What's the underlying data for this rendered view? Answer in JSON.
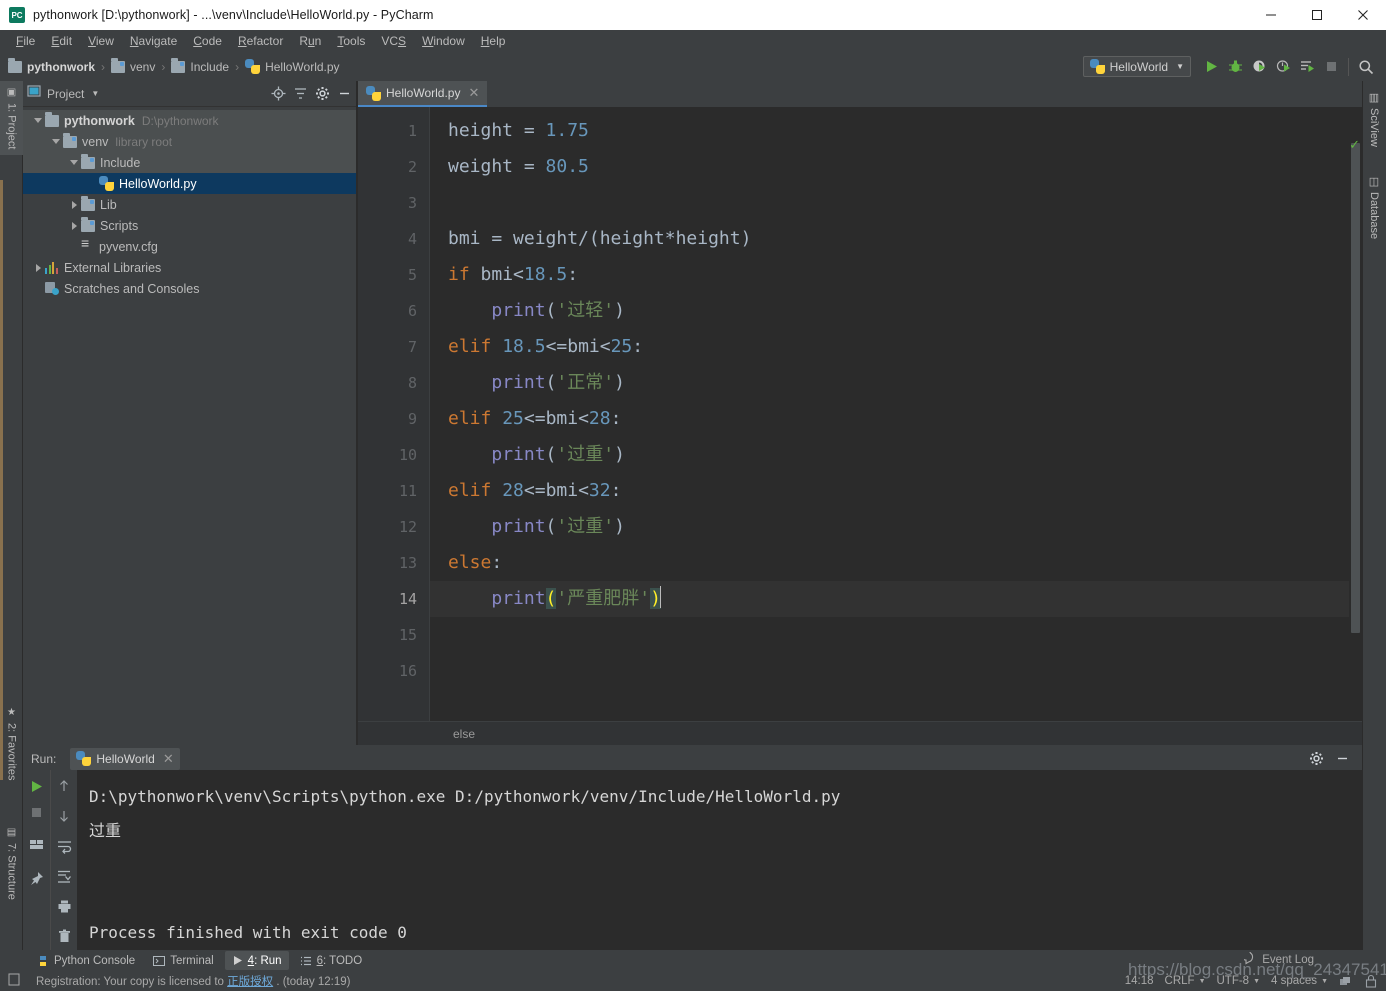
{
  "window": {
    "title": "pythonwork [D:\\pythonwork] - ...\\venv\\Include\\HelloWorld.py - PyCharm",
    "app_icon": "pycharm-icon",
    "minimize": "—",
    "maximize": "□",
    "close": "✕"
  },
  "menu": {
    "items": [
      {
        "label": "File",
        "accel": "F"
      },
      {
        "label": "Edit",
        "accel": "E"
      },
      {
        "label": "View",
        "accel": "V"
      },
      {
        "label": "Navigate",
        "accel": "N"
      },
      {
        "label": "Code",
        "accel": "C"
      },
      {
        "label": "Refactor",
        "accel": "R"
      },
      {
        "label": "Run",
        "accel": "u"
      },
      {
        "label": "Tools",
        "accel": "T"
      },
      {
        "label": "VCS",
        "accel": "S"
      },
      {
        "label": "Window",
        "accel": "W"
      },
      {
        "label": "Help",
        "accel": "H"
      }
    ]
  },
  "navbar": {
    "crumbs": [
      "pythonwork",
      "venv",
      "Include",
      "HelloWorld.py"
    ],
    "separator": "›",
    "run_config": "HelloWorld",
    "toolbar_icons": [
      "run-icon",
      "debug-icon",
      "run-coverage-icon",
      "profile-icon",
      "run-with-console-icon",
      "stop-icon",
      "search-everywhere-icon"
    ]
  },
  "left_strip": {
    "top_tab": {
      "label": "1: Project",
      "accel": "1"
    },
    "bottom_tabs": [
      {
        "label": "2: Favorites",
        "accel": "2",
        "icon": "star-icon"
      },
      {
        "label": "7: Structure",
        "accel": "7",
        "icon": "structure-icon"
      }
    ]
  },
  "right_strip": {
    "tabs": [
      {
        "label": "SciView",
        "icon": "sciview-icon"
      },
      {
        "label": "Database",
        "icon": "database-icon"
      }
    ]
  },
  "project_panel": {
    "title": "Project",
    "caret": "▾",
    "header_icons": [
      "locate-icon",
      "collapse-all-icon",
      "settings-icon",
      "hide-icon"
    ],
    "tree": [
      {
        "label": "pythonwork",
        "sub": "D:\\pythonwork",
        "icon": "folder-icon",
        "depth": 0,
        "expanded": true,
        "bold": true,
        "selected": false,
        "hover": true
      },
      {
        "label": "venv",
        "sub": "library root",
        "icon": "folder-src-icon",
        "depth": 1,
        "expanded": true,
        "bold": false,
        "selected": false,
        "hover": true
      },
      {
        "label": "Include",
        "sub": "",
        "icon": "folder-src-icon",
        "depth": 2,
        "expanded": true,
        "bold": false,
        "selected": false,
        "hover": true
      },
      {
        "label": "HelloWorld.py",
        "sub": "",
        "icon": "python-file-icon",
        "depth": 3,
        "expanded": null,
        "bold": false,
        "selected": true,
        "hover": false
      },
      {
        "label": "Lib",
        "sub": "",
        "icon": "folder-src-icon",
        "depth": 2,
        "expanded": false,
        "bold": false,
        "selected": false,
        "hover": false
      },
      {
        "label": "Scripts",
        "sub": "",
        "icon": "folder-src-icon",
        "depth": 2,
        "expanded": false,
        "bold": false,
        "selected": false,
        "hover": false
      },
      {
        "label": "pyvenv.cfg",
        "sub": "",
        "icon": "config-file-icon",
        "depth": 2,
        "expanded": null,
        "bold": false,
        "selected": false,
        "hover": false
      },
      {
        "label": "External Libraries",
        "sub": "",
        "icon": "libraries-icon",
        "depth": 0,
        "expanded": false,
        "bold": false,
        "selected": false,
        "hover": false
      },
      {
        "label": "Scratches and Consoles",
        "sub": "",
        "icon": "scratches-icon",
        "depth": 0,
        "expanded": null,
        "bold": false,
        "selected": false,
        "hover": false
      }
    ]
  },
  "editor": {
    "tab": {
      "label": "HelloWorld.py",
      "icon": "python-file-icon",
      "close": "✕"
    },
    "breadcrumb": "else",
    "inspection_status": "✓",
    "lines": [
      {
        "num": "1",
        "tokens": [
          {
            "t": "height = ",
            "c": "p"
          },
          {
            "t": "1.75",
            "c": "n"
          }
        ]
      },
      {
        "num": "2",
        "tokens": [
          {
            "t": "weight = ",
            "c": "p"
          },
          {
            "t": "80.5",
            "c": "n"
          }
        ]
      },
      {
        "num": "3",
        "tokens": []
      },
      {
        "num": "4",
        "tokens": [
          {
            "t": "bmi = weight/(height*height)",
            "c": "p"
          }
        ]
      },
      {
        "num": "5",
        "tokens": [
          {
            "t": "if",
            "c": "k"
          },
          {
            "t": " bmi<",
            "c": "p"
          },
          {
            "t": "18.5",
            "c": "n"
          },
          {
            "t": ":",
            "c": "p"
          }
        ]
      },
      {
        "num": "6",
        "tokens": [
          {
            "t": "    ",
            "c": "p"
          },
          {
            "t": "print",
            "c": "f"
          },
          {
            "t": "(",
            "c": "p"
          },
          {
            "t": "'过轻'",
            "c": "s"
          },
          {
            "t": ")",
            "c": "p"
          }
        ]
      },
      {
        "num": "7",
        "tokens": [
          {
            "t": "elif",
            "c": "k"
          },
          {
            "t": " ",
            "c": "p"
          },
          {
            "t": "18.5",
            "c": "n"
          },
          {
            "t": "<=bmi<",
            "c": "p"
          },
          {
            "t": "25",
            "c": "n"
          },
          {
            "t": ":",
            "c": "p"
          }
        ]
      },
      {
        "num": "8",
        "tokens": [
          {
            "t": "    ",
            "c": "p"
          },
          {
            "t": "print",
            "c": "f"
          },
          {
            "t": "(",
            "c": "p"
          },
          {
            "t": "'正常'",
            "c": "s"
          },
          {
            "t": ")",
            "c": "p"
          }
        ]
      },
      {
        "num": "9",
        "tokens": [
          {
            "t": "elif",
            "c": "k"
          },
          {
            "t": " ",
            "c": "p"
          },
          {
            "t": "25",
            "c": "n"
          },
          {
            "t": "<=bmi<",
            "c": "p"
          },
          {
            "t": "28",
            "c": "n"
          },
          {
            "t": ":",
            "c": "p"
          }
        ]
      },
      {
        "num": "10",
        "tokens": [
          {
            "t": "    ",
            "c": "p"
          },
          {
            "t": "print",
            "c": "f"
          },
          {
            "t": "(",
            "c": "p"
          },
          {
            "t": "'过重'",
            "c": "s"
          },
          {
            "t": ")",
            "c": "p"
          }
        ]
      },
      {
        "num": "11",
        "tokens": [
          {
            "t": "elif",
            "c": "k"
          },
          {
            "t": " ",
            "c": "p"
          },
          {
            "t": "28",
            "c": "n"
          },
          {
            "t": "<=bmi<",
            "c": "p"
          },
          {
            "t": "32",
            "c": "n"
          },
          {
            "t": ":",
            "c": "p"
          }
        ]
      },
      {
        "num": "12",
        "tokens": [
          {
            "t": "    ",
            "c": "p"
          },
          {
            "t": "print",
            "c": "f"
          },
          {
            "t": "(",
            "c": "p"
          },
          {
            "t": "'过重'",
            "c": "s"
          },
          {
            "t": ")",
            "c": "p"
          }
        ]
      },
      {
        "num": "13",
        "tokens": [
          {
            "t": "else",
            "c": "k"
          },
          {
            "t": ":",
            "c": "p"
          }
        ]
      },
      {
        "num": "14",
        "tokens": [
          {
            "t": "    ",
            "c": "p"
          },
          {
            "t": "print",
            "c": "f"
          },
          {
            "t": "(",
            "c": "mp"
          },
          {
            "t": "'严重肥胖'",
            "c": "s"
          },
          {
            "t": ")",
            "c": "mp"
          }
        ],
        "current": true,
        "caret": true
      },
      {
        "num": "15",
        "tokens": []
      },
      {
        "num": "16",
        "tokens": []
      }
    ]
  },
  "run_panel": {
    "label": "Run:",
    "tab": {
      "label": "HelloWorld",
      "icon": "python-file-icon",
      "close": "✕"
    },
    "header_icons": [
      "settings-icon",
      "hide-icon"
    ],
    "left_tools": [
      "rerun-icon",
      "stop-icon",
      "restore-layout-icon",
      "pin-icon"
    ],
    "right_tools": [
      "up-icon",
      "down-icon",
      "soft-wrap-icon",
      "scroll-to-end-icon",
      "print-icon",
      "clear-all-icon"
    ],
    "console_lines": [
      "D:\\pythonwork\\venv\\Scripts\\python.exe D:/pythonwork/venv/Include/HelloWorld.py",
      "过重",
      "",
      "",
      "Process finished with exit code 0"
    ]
  },
  "bottom_tabs": [
    {
      "label": "Python Console",
      "icon": "python-console-icon",
      "accel": "",
      "active": false
    },
    {
      "label": "Terminal",
      "icon": "terminal-icon",
      "accel": "",
      "active": false
    },
    {
      "label": "4: Run",
      "icon": "run-icon",
      "accel": "4",
      "active": true
    },
    {
      "label": "6: TODO",
      "icon": "todo-icon",
      "accel": "6",
      "active": false
    }
  ],
  "status_bar": {
    "registration_prefix": "Registration: Your copy is licensed to ",
    "registration_link": "正版授权",
    "registration_suffix": " . (today 12:19)",
    "time": "14:18",
    "line_separator": "CRLF",
    "encoding": "UTF-8",
    "indent": "4 spaces",
    "event_log": "Event Log"
  },
  "watermark": "https://blog.csdn.net/qq_24347541",
  "colors": {
    "window_bg": "#3c3f41",
    "editor_bg": "#2b2b2b",
    "gutter_bg": "#313335",
    "selection_blue": "#0d395f",
    "tab_underline": "#4a88c7",
    "keyword_orange": "#cc7832",
    "number_blue": "#6897bb",
    "string_green": "#6a8759",
    "function_purple": "#8888c6",
    "text_grey": "#a9b7c6",
    "match_paren_bg": "#3b514d",
    "match_paren_fg": "#ffef28",
    "run_green": "#62b543"
  }
}
